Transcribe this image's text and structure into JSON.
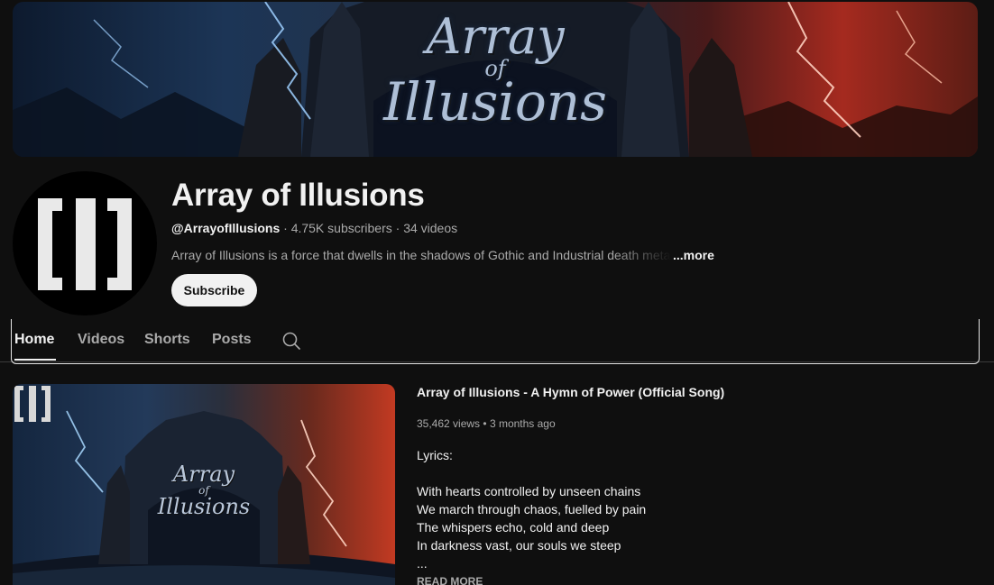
{
  "banner": {
    "title_line1": "Array",
    "title_line2": "of",
    "title_line3": "Illusions"
  },
  "channel": {
    "name": "Array of Illusions",
    "handle": "@ArrayofIllusions",
    "subscribers": "4.75K subscribers",
    "videos": "34 videos",
    "separator": "·",
    "description": "Array of Illusions is a force that dwells in the shadows of Gothic and Industrial death metal",
    "more_label": "...more",
    "subscribe_label": "Subscribe"
  },
  "tabs": [
    {
      "label": "Home",
      "active": true
    },
    {
      "label": "Videos",
      "active": false
    },
    {
      "label": "Shorts",
      "active": false
    },
    {
      "label": "Posts",
      "active": false
    }
  ],
  "search_icon": "search-icon",
  "featured": {
    "thumb_title_line1": "Array",
    "thumb_title_line2": "of",
    "thumb_title_line3": "Illusions",
    "title": "Array of Illusions - A Hymn of Power (Official Song)",
    "views": "35,462 views",
    "age": "3 months ago",
    "dot": "•",
    "lyrics_heading": "Lyrics:",
    "lyrics": [
      "With hearts controlled by unseen chains",
      "We march through chaos, fuelled by pain",
      "The whispers echo, cold and deep",
      "In darkness vast, our souls we steep",
      "..."
    ],
    "read_more_label": "READ MORE"
  },
  "colors": {
    "background": "#0f0f0f",
    "text_primary": "#f1f1f1",
    "text_secondary": "#aaaaaa",
    "subscribe_bg": "#f1f1f1"
  }
}
